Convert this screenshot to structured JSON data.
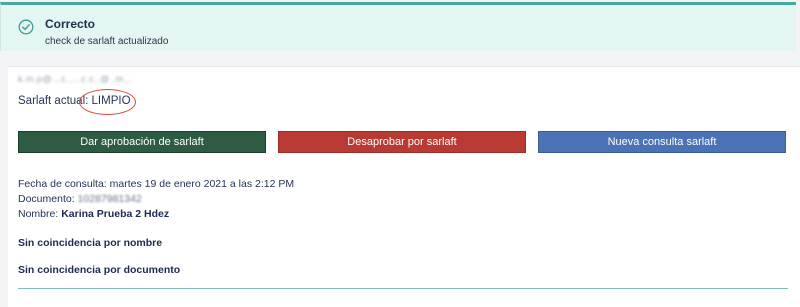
{
  "toast": {
    "icon": "check-circle-icon",
    "title": "Correcto",
    "message": "check de sarlaft actualizado",
    "accent_color": "#47a7a0"
  },
  "card": {
    "blurred_email": "k.m.p@...c.....c.c..@..m...",
    "status_label": "Sarlaft actual:",
    "status_value": "LIMPIO",
    "buttons": {
      "approve": "Dar aprobación de sarlaft",
      "reject": "Desaprobar por sarlaft",
      "new_query": "Nueva consulta sarlaft"
    },
    "colors": {
      "approve": "#2d5c43",
      "reject": "#b83a33",
      "new_query": "#4a72b5"
    },
    "query_date_label": "Fecha de consulta:",
    "query_date_value": "martes 19 de enero 2021 a las 2:12 PM",
    "document_label": "Documento:",
    "document_value": "10287981342",
    "name_label": "Nombre:",
    "name_value": "Karina Prueba 2 Hdez",
    "no_match_name": "Sin coincidencia por nombre",
    "no_match_document": "Sin coincidencia por documento"
  }
}
